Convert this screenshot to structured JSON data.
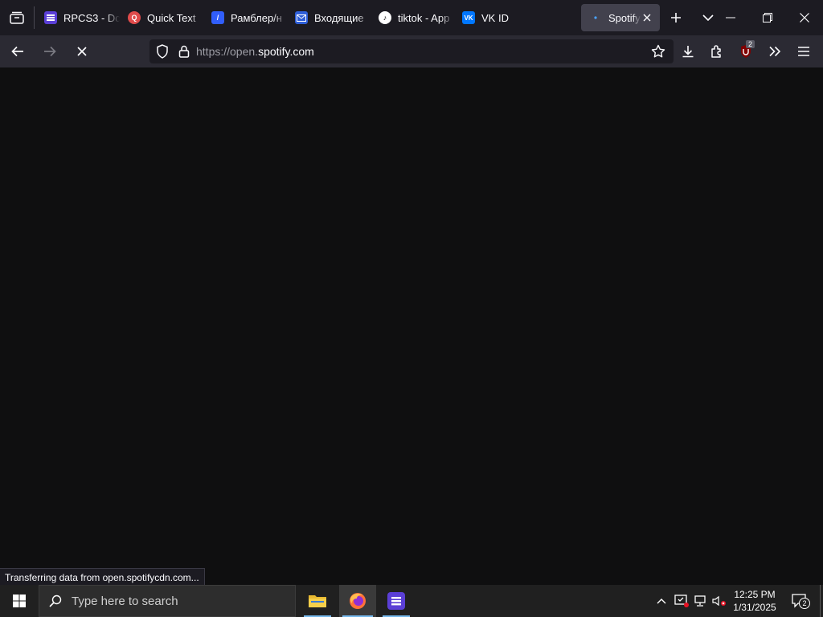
{
  "tabs": [
    {
      "title": "RPCS3 - Dc",
      "icon": "rpcs3-icon",
      "color": "#5b3fd6"
    },
    {
      "title": "Quick Text",
      "icon": "quicktext-icon",
      "color": "#e04b4b"
    },
    {
      "title": "Рамблер/н",
      "icon": "rambler-icon",
      "color": "#315efb"
    },
    {
      "title": "Входящие",
      "icon": "mail-icon",
      "color": "#2f5fd8"
    },
    {
      "title": "tiktok - App",
      "icon": "tiktok-icon",
      "color": "#ffffff"
    },
    {
      "title": "VK ID",
      "icon": "vk-icon",
      "color": "#0077ff"
    },
    {
      "title": "Spotify -",
      "icon": "loading-icon",
      "color": "#4aa3ff"
    }
  ],
  "url": {
    "prefix": "https://open.",
    "domain": "spotify.com"
  },
  "extension_badge": "2",
  "status_text": "Transferring data from open.spotifycdn.com...",
  "taskbar": {
    "search_placeholder": "Type here to search",
    "time": "12:25 PM",
    "date": "1/31/2025",
    "notification_count": "2"
  },
  "colors": {
    "accent": "#76b9ed",
    "page_bg": "#0f0f10",
    "toolbar_bg": "#2b2a33",
    "tabstrip_bg": "#1c1b22"
  }
}
